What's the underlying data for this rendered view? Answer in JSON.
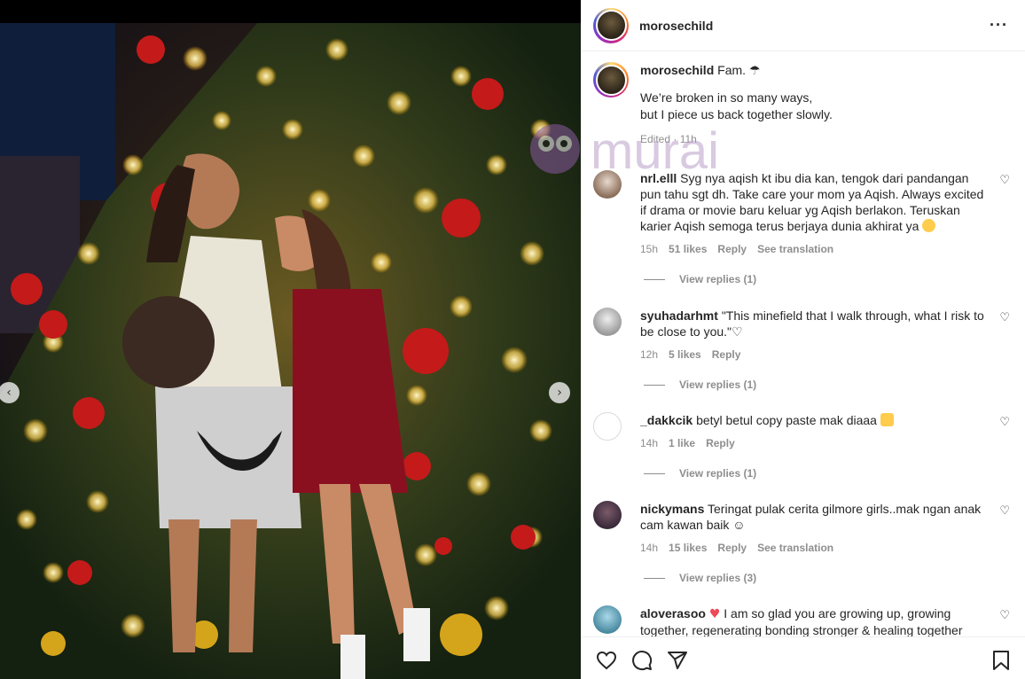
{
  "post": {
    "username": "morosechild"
  },
  "caption": {
    "username": "morosechild",
    "line1": "Fam. ☂",
    "line2": "We’re broken in so many ways,",
    "line3": "but I piece us back together slowly.",
    "meta": "Edited · 11h"
  },
  "comments": [
    {
      "username": "nrl.elll",
      "text": "Syg nya aqish kt ibu dia kan, tengok dari pandangan pun tahu sgt dh. Take care your mom ya Aqish. Always excited if drama or movie baru keluar yg Aqish berlakon. Teruskan karier Aqish semoga terus berjaya dunia akhirat ya",
      "emoji": "smiling-face-with-hearts",
      "time": "15h",
      "likes": "51 likes",
      "reply": "Reply",
      "translate": "See translation",
      "replies": "View replies (1)"
    },
    {
      "username": "syuhadarhmt",
      "text": "\"This minefield that I walk through, what I risk to be close to you.\"♡",
      "time": "12h",
      "likes": "5 likes",
      "reply": "Reply",
      "replies": "View replies (1)"
    },
    {
      "username": "_dakkcik",
      "text": "betyl betul copy paste mak diaaa",
      "emoji": "star-struck",
      "time": "14h",
      "likes": "1 like",
      "reply": "Reply",
      "replies": "View replies (1)"
    },
    {
      "username": "nickymans",
      "text": "Teringat pulak cerita gilmore girls..mak ngan anak cam kawan baik ☺",
      "time": "14h",
      "likes": "15 likes",
      "reply": "Reply",
      "translate": "See translation",
      "replies": "View replies (3)"
    },
    {
      "username": "aloverasoo",
      "text": "I am so glad you are growing up, growing together, regenerating bonding stronger & healing together"
    }
  ],
  "icons": {
    "more": "more-horizontal-icon",
    "like": "heart-icon",
    "comment": "comment-icon",
    "share": "send-icon",
    "save": "bookmark-icon"
  },
  "watermark": {
    "text": "murai"
  },
  "colors": {
    "text": "#262626",
    "muted": "#8e8e8e",
    "border": "#efefef",
    "heart_red": "#ed4956"
  }
}
